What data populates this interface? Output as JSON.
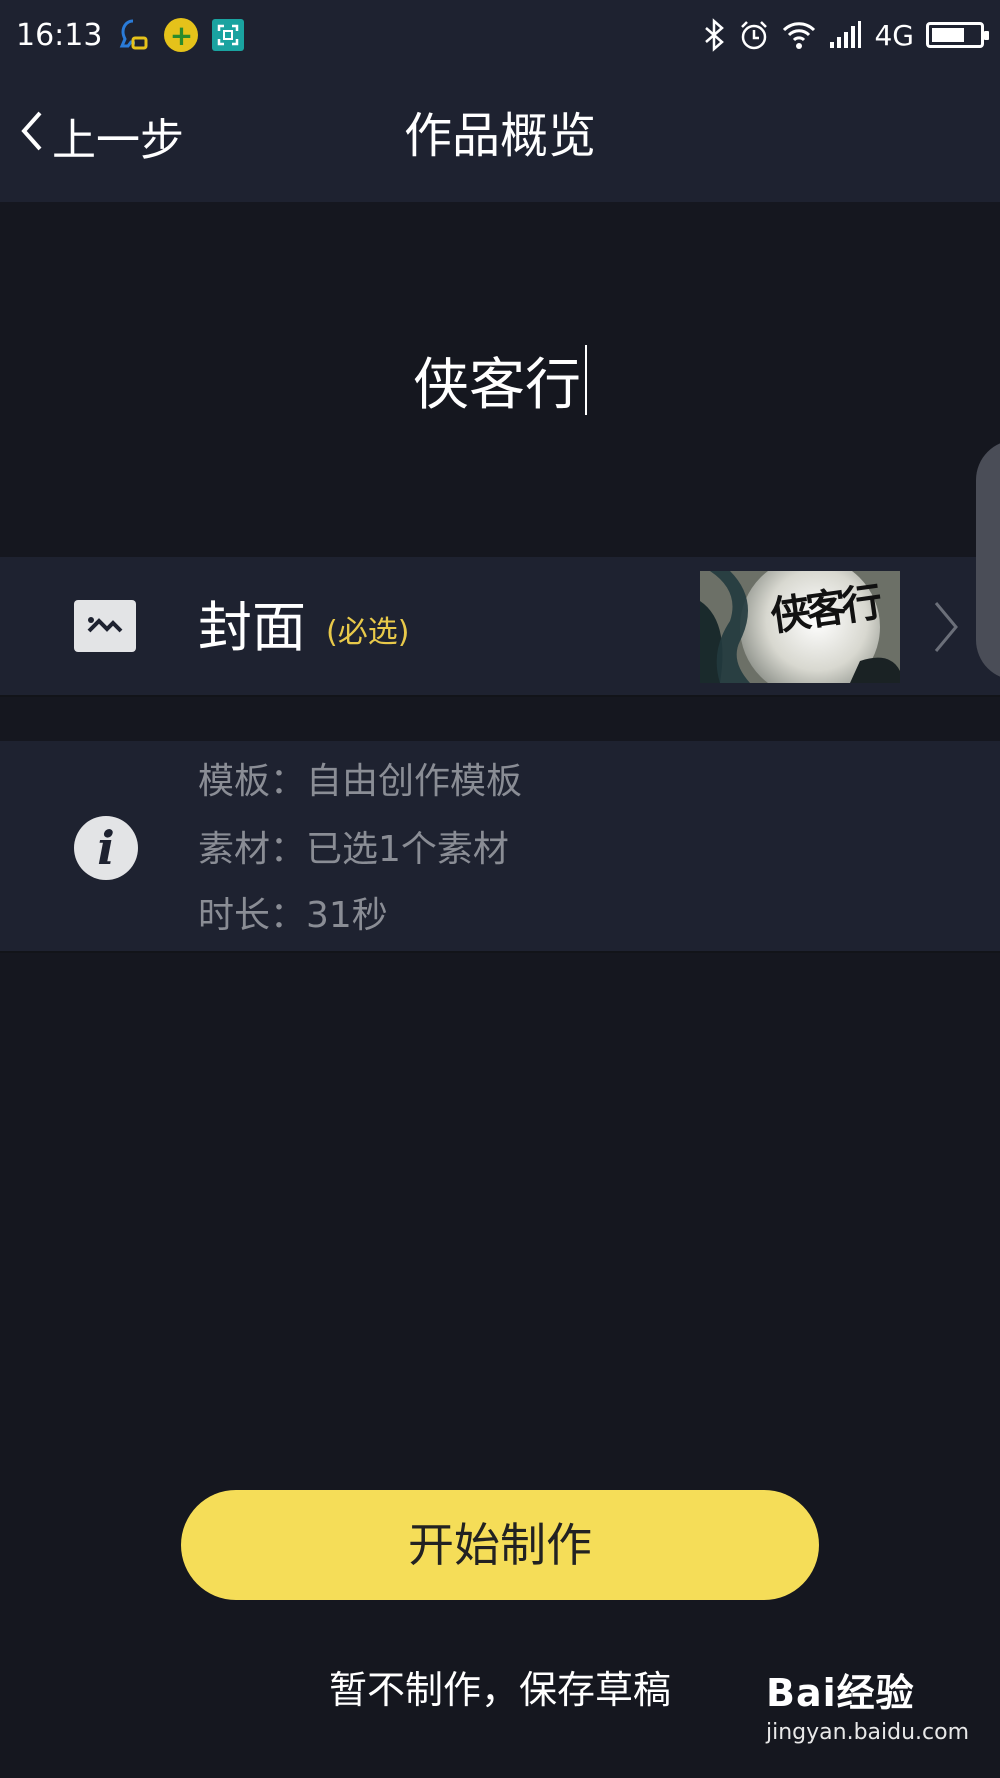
{
  "status_bar": {
    "time": "16:13",
    "network": "4G",
    "icons": [
      "qq-icon",
      "360-icon",
      "scan-icon",
      "bluetooth-icon",
      "alarm-icon",
      "wifi-icon",
      "signal-icon",
      "battery-icon"
    ],
    "battery_level": 0.7
  },
  "header": {
    "back_label": "上一步",
    "title": "作品概览"
  },
  "work": {
    "title": "侠客行"
  },
  "cover": {
    "label": "封面",
    "required": "(必选)",
    "thumb_text": "侠客行"
  },
  "info": {
    "template": "模板：自由创作模板",
    "materials": "素材：已选1个素材",
    "duration": "时长：31秒"
  },
  "actions": {
    "start_label": "开始制作",
    "draft_label": "暂不制作，保存草稿"
  },
  "watermark": {
    "brand": "Bai经验",
    "url": "jingyan.baidu.com"
  },
  "colors": {
    "accent": "#f5dd58",
    "required": "#e8c94a",
    "background": "#15171f",
    "panel": "#1e2230"
  }
}
